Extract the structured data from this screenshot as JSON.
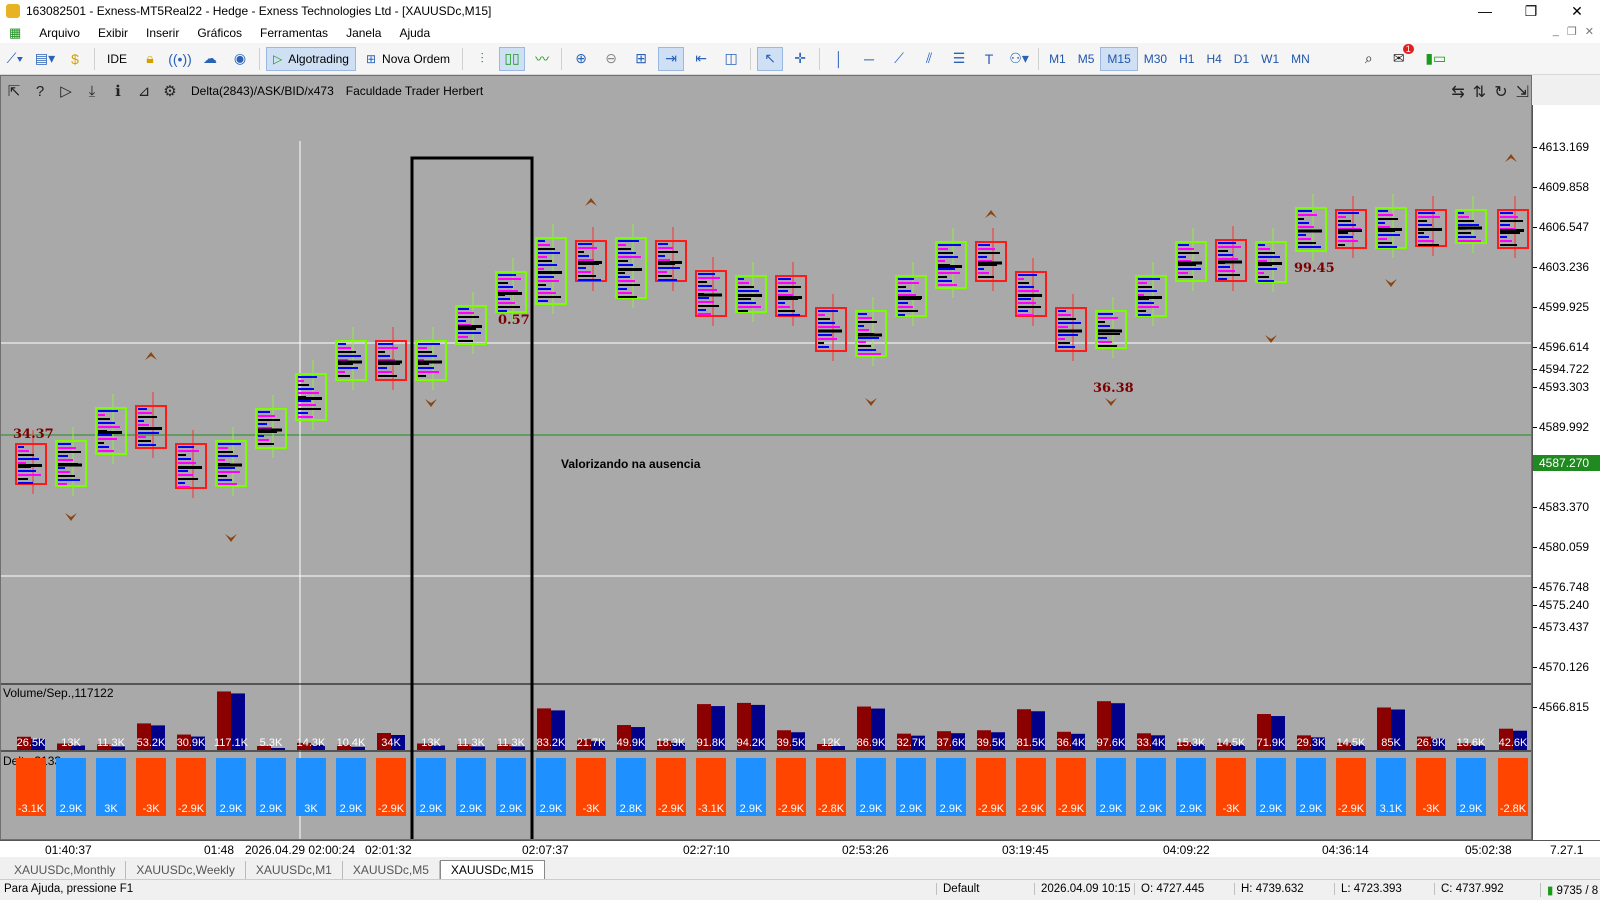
{
  "window": {
    "title": "163082501 - Exness-MT5Real22 - Hedge - Exness Technologies Ltd - [XAUUSDc,M15]",
    "controls": [
      "—",
      "❐",
      "✕"
    ]
  },
  "menu": [
    "Arquivo",
    "Exibir",
    "Inserir",
    "Gráficos",
    "Ferramentas",
    "Janela",
    "Ajuda"
  ],
  "toolbar": {
    "ide_label": "IDE",
    "algotrading_label": "Algotrading",
    "nova_ordem_label": "Nova Ordem",
    "timeframes": [
      "M1",
      "M5",
      "M15",
      "M30",
      "H1",
      "H4",
      "D1",
      "W1",
      "MN"
    ],
    "active_timeframe": "M15",
    "notification_count": "1"
  },
  "chart": {
    "indicator_label": "Delta(2843)/ASK/BID/x473",
    "custom_label": "Faculdade Trader Herbert",
    "annotation_text": "Valorizando na ausencia",
    "volume_label": "Volume/Sep.,117122",
    "delta_label": "Delta,3133",
    "current_price": "4587.270",
    "price_labels": [
      "4613.169",
      "4609.858",
      "4606.547",
      "4603.236",
      "4599.925",
      "4596.614",
      "4594.722",
      "4593.303",
      "4589.992",
      "4583.370",
      "4580.059",
      "4576.748",
      "4575.240",
      "4573.437",
      "4570.126",
      "4566.815"
    ],
    "delta_values_on_chart": [
      "34.37",
      "0.57",
      "99.45",
      "36.38"
    ],
    "volume_labels": [
      "26.5K",
      "13K",
      "11.3K",
      "53.2K",
      "30.9K",
      "117.1K",
      "5.3K",
      "14.3K",
      "10.4K",
      "34K",
      "13K",
      "11.3K",
      "11.3K",
      "83.2K",
      "21.7K",
      "49.9K",
      "18.3K",
      "91.8K",
      "94.2K",
      "39.5K",
      "12K",
      "86.9K",
      "32.7K",
      "37.6K",
      "39.5K",
      "81.5K",
      "36.4K",
      "97.6K",
      "33.4K",
      "15.3K",
      "14.5K",
      "71.9K",
      "29.3K",
      "14.5K",
      "85K",
      "26.9K",
      "13.6K",
      "42.6K"
    ],
    "delta_labels": [
      "-3.1K",
      "2.9K",
      "3K",
      "-3K",
      "-2.9K",
      "2.9K",
      "2.9K",
      "3K",
      "2.9K",
      "-2.9K",
      "2.9K",
      "2.9K",
      "2.9K",
      "2.9K",
      "-3K",
      "2.8K",
      "-2.9K",
      "-3.1K",
      "2.9K",
      "-2.9K",
      "-2.8K",
      "2.9K",
      "2.9K",
      "2.9K",
      "-2.9K",
      "-2.9K",
      "-2.9K",
      "2.9K",
      "2.9K",
      "2.9K",
      "-3K",
      "2.9K",
      "2.9K",
      "-2.9K",
      "3.1K",
      "-3K",
      "2.9K",
      "-2.8K"
    ],
    "time_labels": [
      "01:40:37",
      "01:48",
      "2026.04.29 02:00:24",
      "02:01:32",
      "02:07:37",
      "02:27:10",
      "02:53:26",
      "03:19:45",
      "04:09:22",
      "04:36:14",
      "05:02:38",
      "7.27.1"
    ],
    "colors": {
      "bull": "#7cfc00",
      "bear": "#ff1a1a",
      "delta_pos": "#1e90ff",
      "delta_neg": "#ff4500",
      "vol_ask": "#8b0000",
      "vol_bid": "#00008b"
    }
  },
  "tabs": [
    "XAUUSDc,Monthly",
    "XAUUSDc,Weekly",
    "XAUUSDc,M1",
    "XAUUSDc,M5",
    "XAUUSDc,M15"
  ],
  "active_tab": "XAUUSDc,M15",
  "status": {
    "help": "Para Ajuda, pressione F1",
    "profile": "Default",
    "datetime": "2026.04.09 10:15",
    "open": "O: 4727.445",
    "high": "H: 4739.632",
    "low": "L: 4723.393",
    "close": "C: 4737.992",
    "traffic": "9735 / 8 Kb"
  }
}
